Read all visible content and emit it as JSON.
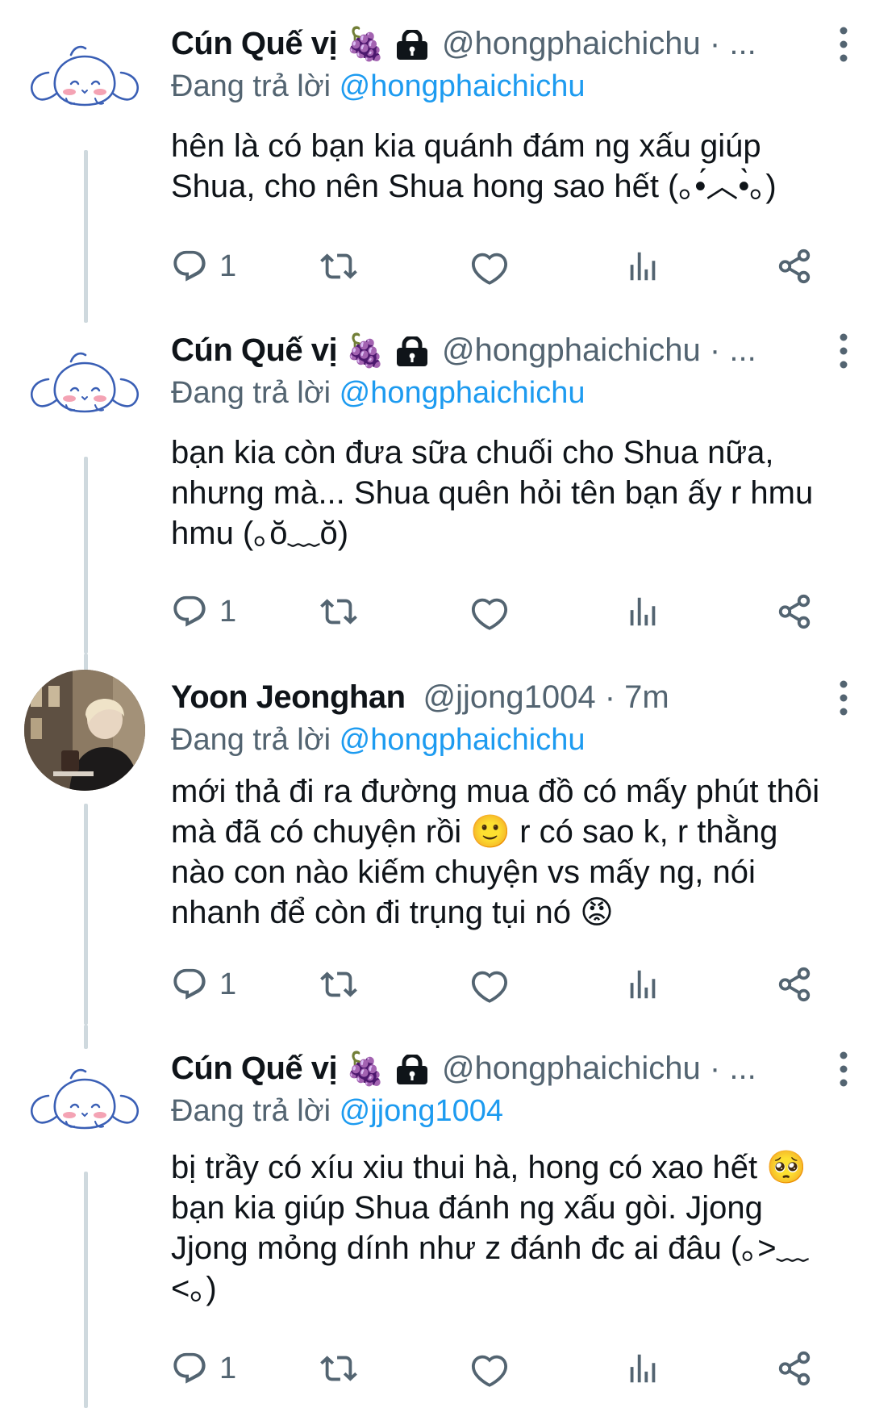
{
  "replying_prefix": "Đang trả lời",
  "tweets": [
    {
      "name": "Cún Quế vị",
      "emoji": "🍇",
      "handle": "@hongphaichichu · ...",
      "replying_to": "@hongphaichichu",
      "text": "hên là có bạn kia quánh đám ng xấu giúp Shua, cho nên Shua hong sao hết (｡•́︿•̀｡)",
      "reply_count": "1"
    },
    {
      "name": "Cún Quế vị",
      "emoji": "🍇",
      "handle": "@hongphaichichu · ...",
      "replying_to": "@hongphaichichu",
      "text": "bạn kia còn đưa sữa chuối cho Shua nữa, nhưng mà... Shua quên hỏi tên bạn ấy r hmu hmu (｡ŏ﹏ŏ)",
      "reply_count": "1"
    },
    {
      "name": "Yoon Jeonghan",
      "emoji": "",
      "handle": "@jjong1004 · 7m",
      "replying_to": "@hongphaichichu",
      "text_parts": [
        "mới thả đi ra đường mua đồ có mấy phút thôi mà đã có chuyện rồi ",
        "🙂",
        " r có sao k, r thằng nào con nào kiếm chuyện vs mấy ng, nói nhanh để còn đi trụng tụi nó ",
        "😡"
      ],
      "reply_count": "1"
    },
    {
      "name": "Cún Quế vị",
      "emoji": "🍇",
      "handle": "@hongphaichichu · ...",
      "replying_to": "@jjong1004",
      "text_parts": [
        "bị trầy có xíu xiu thui hà, hong có xao hết ",
        "🥺",
        " bạn kia giúp Shua đánh ng xấu gòi. Jjong Jjong mỏng dính như z đánh đc ai đâu (｡>﹏<｡)"
      ],
      "reply_count": "1"
    }
  ],
  "colors": {
    "text": "#0f1419",
    "secondary": "#536471",
    "mention": "#1d9bf0",
    "thread_line": "#cfd9de"
  },
  "icons": [
    "reply-icon",
    "retweet-icon",
    "like-icon",
    "views-icon",
    "share-icon",
    "more-icon",
    "lock-icon",
    "grapes-icon"
  ]
}
